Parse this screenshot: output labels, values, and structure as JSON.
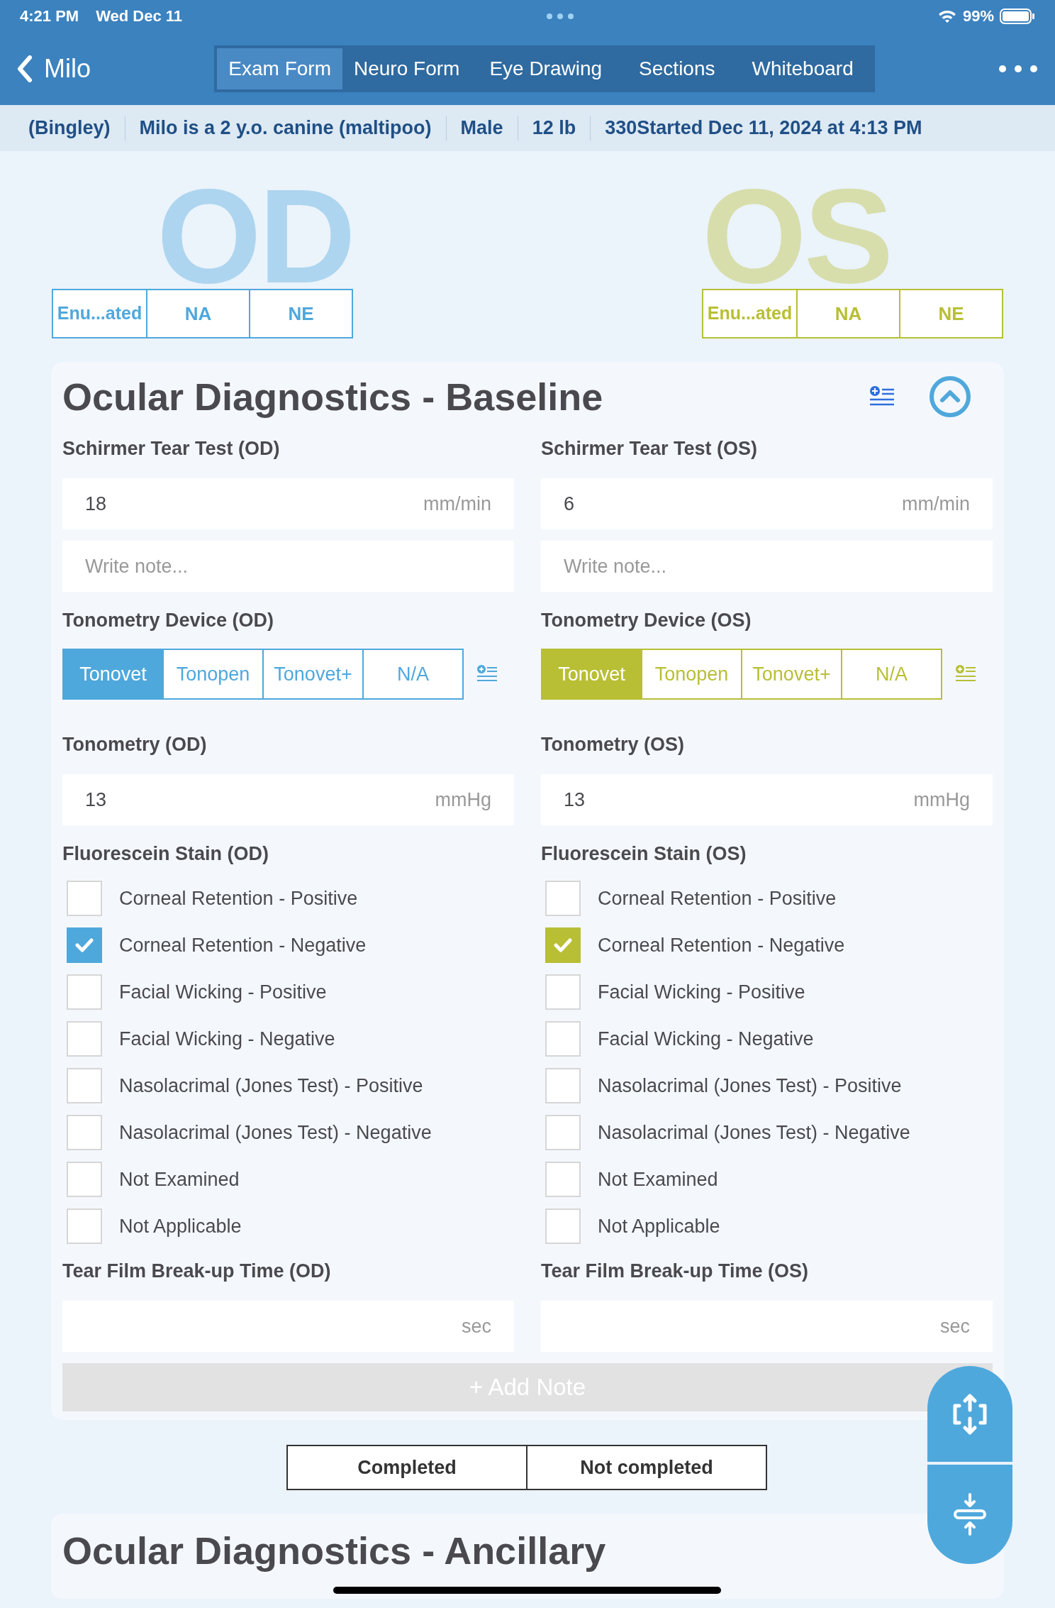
{
  "status_bar": {
    "time": "4:21 PM",
    "date": "Wed Dec 11",
    "battery": "99%"
  },
  "nav": {
    "back_label": "Milo",
    "tabs": [
      {
        "label": "Exam Form",
        "selected": true
      },
      {
        "label": "Neuro Form",
        "selected": false
      },
      {
        "label": "Eye Drawing",
        "selected": false
      },
      {
        "label": "Sections",
        "selected": false
      },
      {
        "label": "Whiteboard",
        "selected": false
      }
    ]
  },
  "patient_info": [
    "(Bingley)",
    "Milo is a 2 y.o. canine (maltipoo)",
    "Male",
    "12 lb",
    "330Started Dec 11, 2024 at 4:13 PM"
  ],
  "eyes": [
    {
      "label": "OD",
      "color": "#4fa8dc",
      "options": [
        {
          "label": "Enu...ated",
          "selected": false
        },
        {
          "label": "NA",
          "selected": false
        },
        {
          "label": "NE",
          "selected": false
        }
      ]
    },
    {
      "label": "OS",
      "color": "#b8bf35",
      "options": [
        {
          "label": "Enu...ated",
          "selected": false
        },
        {
          "label": "NA",
          "selected": false
        },
        {
          "label": "NE",
          "selected": false
        }
      ]
    }
  ],
  "section": {
    "title": "Ocular Diagnostics - Baseline",
    "expanded": true,
    "columns": [
      {
        "color": "#4fa8dc",
        "fields": [
          {
            "kind": "measure",
            "label": "Schirmer Tear Test (OD)",
            "value": "18",
            "unit": "mm/min"
          },
          {
            "kind": "note",
            "placeholder": "Write note..."
          },
          {
            "kind": "segmented",
            "label": "Tonometry Device (OD)",
            "options": [
              {
                "label": "Tonovet",
                "selected": true
              },
              {
                "label": "Tonopen",
                "selected": false
              },
              {
                "label": "Tonovet+",
                "selected": false
              },
              {
                "label": "N/A",
                "selected": false
              }
            ]
          },
          {
            "kind": "measure",
            "label": "Tonometry (OD)",
            "value": "13",
            "unit": "mmHg"
          },
          {
            "kind": "checklist",
            "label": "Fluorescein Stain (OD)",
            "items": [
              {
                "label": "Corneal Retention - Positive",
                "checked": false
              },
              {
                "label": "Corneal Retention - Negative",
                "checked": true
              },
              {
                "label": "Facial Wicking - Positive",
                "checked": false
              },
              {
                "label": "Facial Wicking - Negative",
                "checked": false
              },
              {
                "label": "Nasolacrimal (Jones Test) - Positive",
                "checked": false
              },
              {
                "label": "Nasolacrimal (Jones Test) - Negative",
                "checked": false
              },
              {
                "label": "Not Examined",
                "checked": false
              },
              {
                "label": "Not Applicable",
                "checked": false
              }
            ]
          },
          {
            "kind": "measure",
            "label": "Tear Film Break-up Time (OD)",
            "unit": "sec"
          }
        ]
      },
      {
        "color": "#b8bf35",
        "fields": [
          {
            "kind": "measure",
            "label": "Schirmer Tear Test (OS)",
            "value": "6",
            "unit": "mm/min"
          },
          {
            "kind": "note",
            "placeholder": "Write note..."
          },
          {
            "kind": "segmented",
            "label": "Tonometry Device (OS)",
            "options": [
              {
                "label": "Tonovet",
                "selected": true
              },
              {
                "label": "Tonopen",
                "selected": false
              },
              {
                "label": "Tonovet+",
                "selected": false
              },
              {
                "label": "N/A",
                "selected": false
              }
            ]
          },
          {
            "kind": "measure",
            "label": "Tonometry (OS)",
            "value": "13",
            "unit": "mmHg"
          },
          {
            "kind": "checklist",
            "label": "Fluorescein Stain (OS)",
            "items": [
              {
                "label": "Corneal Retention - Positive",
                "checked": false
              },
              {
                "label": "Corneal Retention - Negative",
                "checked": true
              },
              {
                "label": "Facial Wicking - Positive",
                "checked": false
              },
              {
                "label": "Facial Wicking - Negative",
                "checked": false
              },
              {
                "label": "Nasolacrimal (Jones Test) - Positive",
                "checked": false
              },
              {
                "label": "Nasolacrimal (Jones Test) - Negative",
                "checked": false
              },
              {
                "label": "Not Examined",
                "checked": false
              },
              {
                "label": "Not Applicable",
                "checked": false
              }
            ]
          },
          {
            "kind": "measure",
            "label": "Tear Film Break-up Time (OS)",
            "unit": "sec"
          }
        ]
      }
    ],
    "add_note": "+ Add Note"
  },
  "completion": [
    {
      "label": "Completed",
      "selected": false
    },
    {
      "label": "Not completed",
      "selected": false
    }
  ],
  "next_section": {
    "title": "Ocular Diagnostics - Ancillary"
  }
}
